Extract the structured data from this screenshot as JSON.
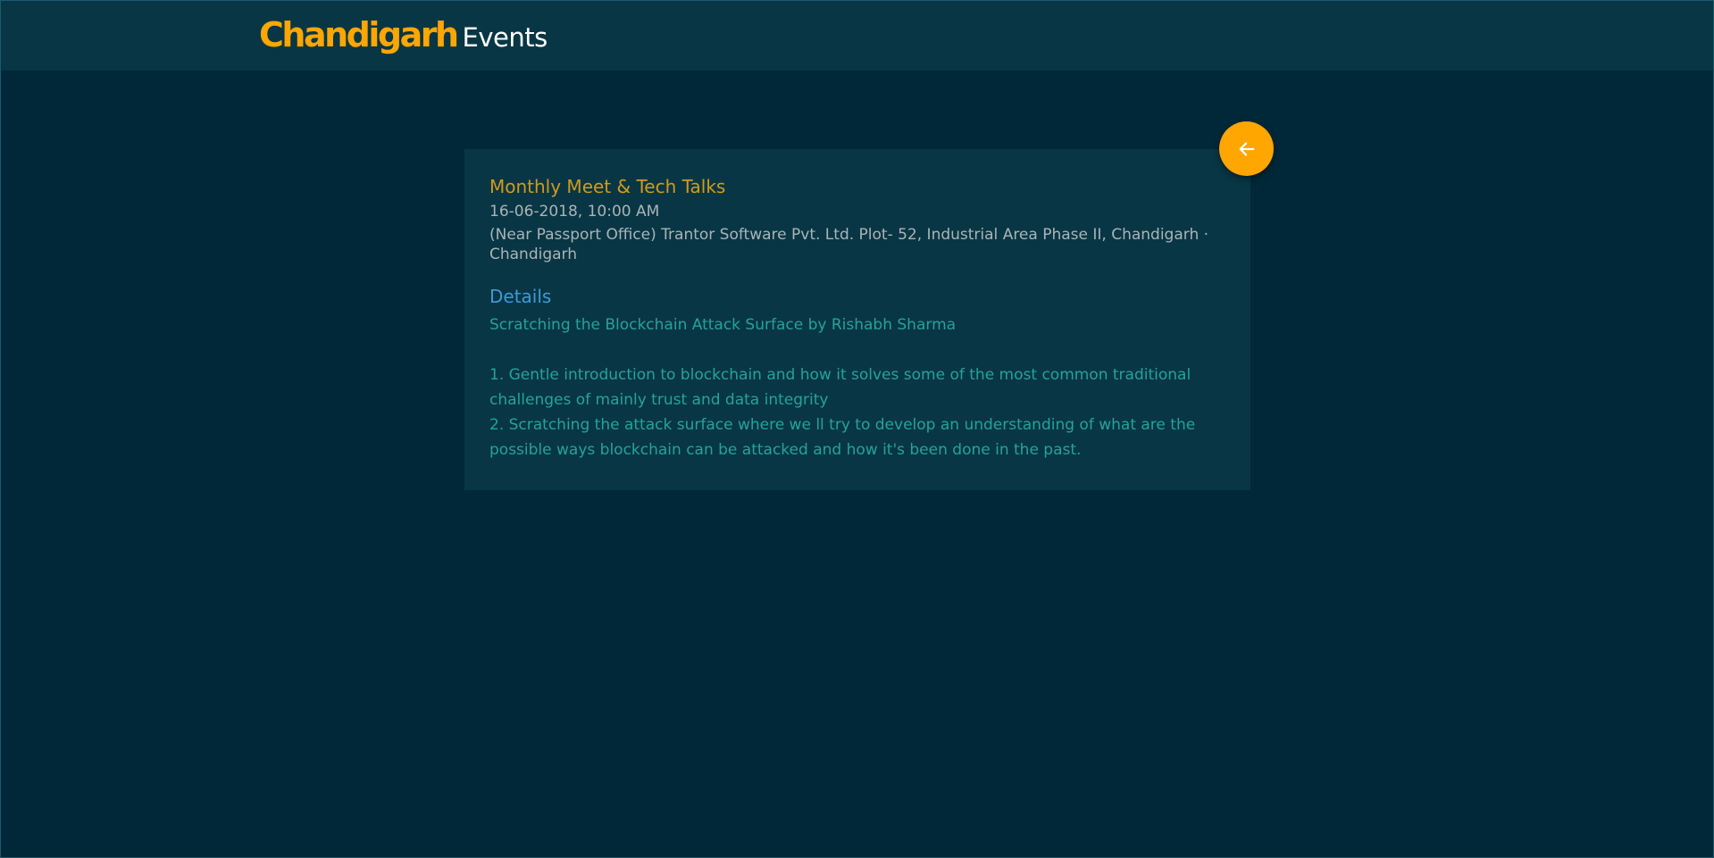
{
  "header": {
    "brand_main": "Chandigarh",
    "brand_sub": "Events"
  },
  "event": {
    "title": "Monthly Meet & Tech Talks",
    "datetime": "16-06-2018, 10:00 AM",
    "location": "(Near Passport Office) Trantor Software Pvt. Ltd. Plot- 52, Industrial Area Phase II, Chandigarh · Chandigarh"
  },
  "details": {
    "heading": "Details",
    "talk_title": "Scratching the Blockchain Attack Surface by Rishabh Sharma",
    "point_1": "1. Gentle introduction to blockchain and how it solves some of the most common traditional challenges of mainly trust and data integrity",
    "point_2": "2. Scratching the attack surface where we ll try to develop an understanding of what are the possible ways blockchain can be attacked and how it's been done in the past."
  },
  "back_button": {
    "icon": "arrow-left-icon"
  },
  "colors": {
    "background": "#002838",
    "header_bg": "#083644",
    "accent": "#ffa600",
    "title": "#d09a1c",
    "meta_text": "#aab4b8",
    "details_heading": "#3e9ad6",
    "details_text": "#23a39a"
  }
}
